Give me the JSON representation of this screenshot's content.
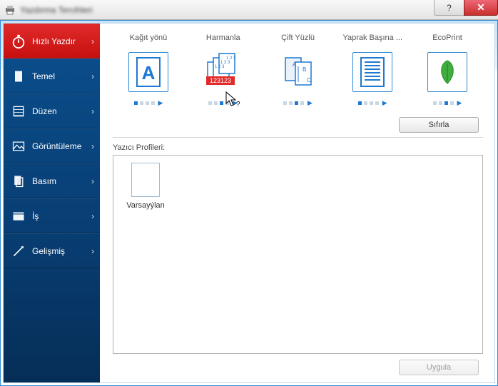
{
  "window": {
    "title": "Yazdırma Tercihleri"
  },
  "sidebar": {
    "items": [
      {
        "label": "Hızlı Yazdır",
        "icon": "stopwatch-icon",
        "active": true
      },
      {
        "label": "Temel",
        "icon": "document-icon",
        "active": false
      },
      {
        "label": "Düzen",
        "icon": "layout-icon",
        "active": false
      },
      {
        "label": "Görüntüleme",
        "icon": "image-icon",
        "active": false
      },
      {
        "label": "Basım",
        "icon": "pages-icon",
        "active": false
      },
      {
        "label": "İş",
        "icon": "job-icon",
        "active": false
      },
      {
        "label": "Gelişmiş",
        "icon": "advanced-icon",
        "active": false
      }
    ]
  },
  "options": [
    {
      "label": "Kağıt yönü",
      "icon": "orientation",
      "dotActive": 0,
      "dotCount": 4
    },
    {
      "label": "Harmanla",
      "icon": "collate",
      "dotActive": 2,
      "dotCount": 4
    },
    {
      "label": "Çift Yüzlü",
      "icon": "duplex",
      "dotActive": 2,
      "dotCount": 4
    },
    {
      "label": "Yaprak Başına ...",
      "icon": "pages-per",
      "dotActive": 0,
      "dotCount": 4
    },
    {
      "label": "EcoPrint",
      "icon": "eco",
      "dotActive": 2,
      "dotCount": 4
    }
  ],
  "buttons": {
    "reset": "Sıfırla",
    "apply": "Uygula"
  },
  "profiles": {
    "label": "Yazıcı Profileri:",
    "items": [
      {
        "name": "Varsayýlan"
      }
    ]
  },
  "collate_overlay": "123123"
}
